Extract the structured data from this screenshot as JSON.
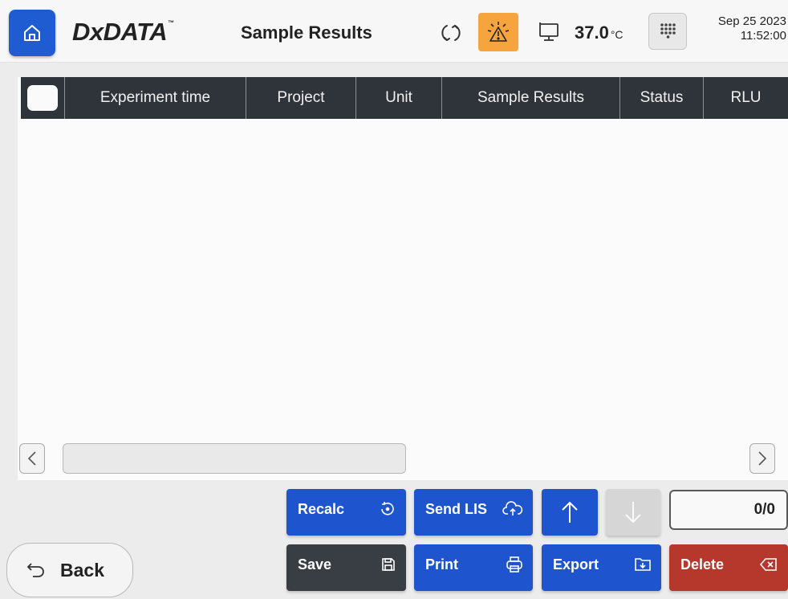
{
  "header": {
    "logo": "DxDATA",
    "logo_tm": "™",
    "title": "Sample Results",
    "temperature": "37.0",
    "temperature_unit": "°C",
    "date": "Sep 25 2023",
    "time": "11:52:00",
    "alarm_color": "#f6a43d"
  },
  "table": {
    "columns": [
      "Experiment time",
      "Project",
      "Unit",
      "Sample Results",
      "Status",
      "RLU"
    ],
    "rows": []
  },
  "footer": {
    "recalc_label": "Recalc",
    "send_lis_label": "Send LIS",
    "save_label": "Save",
    "print_label": "Print",
    "export_label": "Export",
    "delete_label": "Delete",
    "back_label": "Back",
    "page_counter": "0/0"
  },
  "colors": {
    "primary_blue": "#1e55cf",
    "dark_button": "#393d44",
    "delete_red": "#b6372c",
    "header_bar": "#2f333a"
  },
  "icons": {
    "home": "home-icon",
    "sync": "sync-icon",
    "alarm": "warning-icon",
    "device": "device-icon",
    "keypad": "keypad-icon"
  }
}
